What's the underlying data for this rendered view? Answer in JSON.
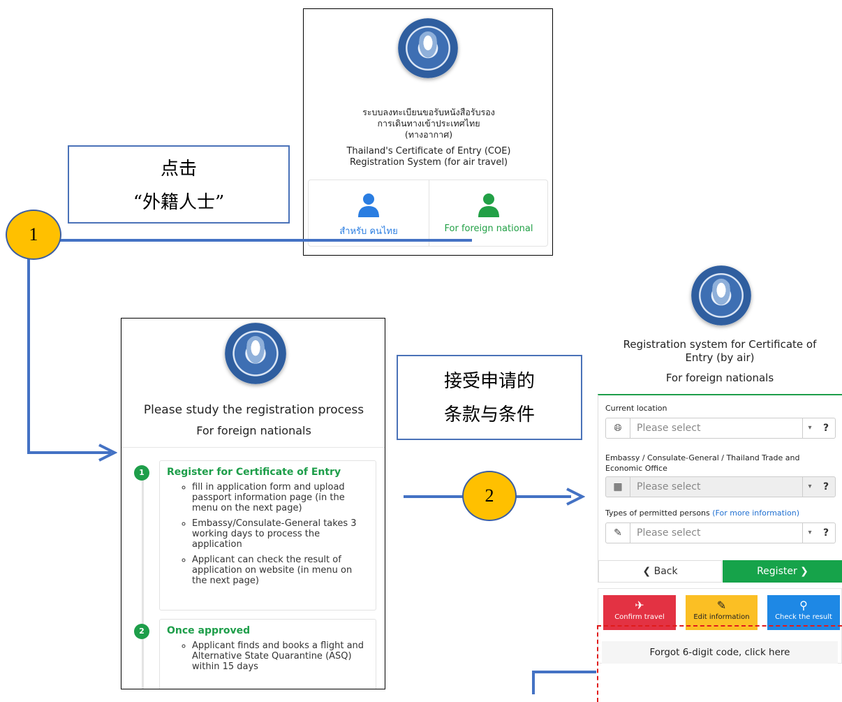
{
  "panel1": {
    "thai_title_line1": "ระบบลงทะเบียนขอรับหนังสือรับรอง",
    "thai_title_line2": "การเดินทางเข้าประเทศไทย",
    "thai_title_line3": "(ทางอากาศ)",
    "en_title_line1": "Thailand's Certificate of Entry (COE)",
    "en_title_line2": "Registration System (for air travel)",
    "thai_option_label": "สำหรับ คนไทย",
    "foreign_option_label": "For foreign national",
    "colors": {
      "thai_icon": "#2a7de1",
      "foreign_icon": "#22a046"
    }
  },
  "note1": {
    "line1": "点击",
    "line2": "“外籍人士”"
  },
  "step1_number": "1",
  "panel2": {
    "heading_line1": "Please study the registration process",
    "heading_line2": "For foreign nationals",
    "steps": [
      {
        "num": "1",
        "title": "Register for Certificate of Entry",
        "items": [
          "fill in application form and upload passport information page (in the menu on the next page)",
          "Embassy/Consulate-General takes 3 working days to process the application",
          "Applicant can check the result of application on website (in menu on the next page)"
        ]
      },
      {
        "num": "2",
        "title": "Once approved",
        "items": [
          "Applicant finds and books a flight and Alternative State Quarantine (ASQ) within 15 days"
        ]
      }
    ]
  },
  "note2": {
    "line1": "接受申请的",
    "line2": "条款与条件"
  },
  "step2_number": "2",
  "panel3": {
    "title_line1": "Registration system for Certificate of",
    "title_line2": "Entry (by air)",
    "subtitle": "For foreign nationals",
    "current_location_label": "Current location",
    "select_placeholder": "Please select",
    "embassy_label": "Embassy / Consulate-General / Thailand Trade and Economic Office",
    "permitted_label": "Types of permitted persons",
    "more_info_link": "(For more information)",
    "back_button": "Back",
    "register_button": "Register",
    "confirm_travel": "Confirm travel",
    "edit_information": "Edit information",
    "check_result": "Check the result",
    "forgot_code": "Forgot 6-digit code, click here",
    "colors": {
      "register": "#16a34a",
      "confirm": "#e33243",
      "edit": "#fbbf24",
      "check": "#1e88e5",
      "link": "#1f6fd1"
    }
  }
}
